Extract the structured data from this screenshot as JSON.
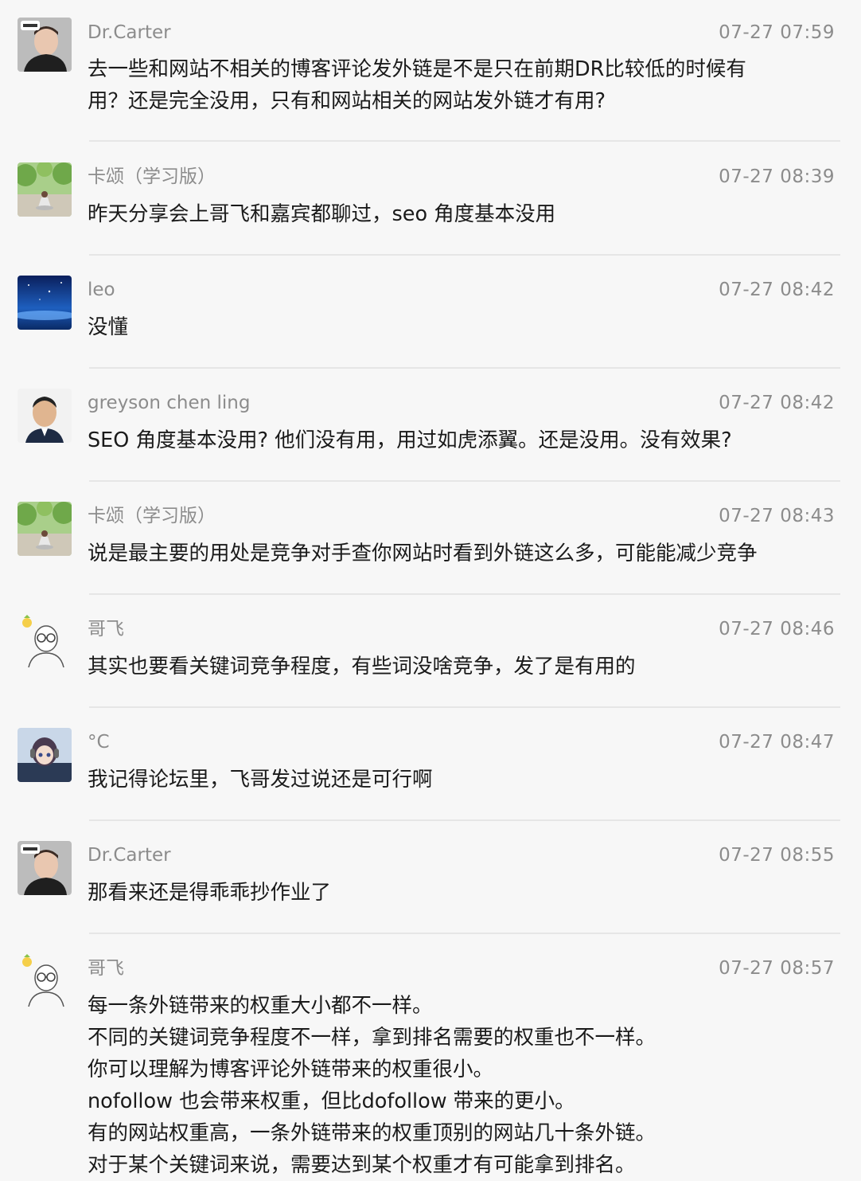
{
  "messages": [
    {
      "name": "Dr.Carter",
      "time": "07-27 07:59",
      "text": "去一些和网站不相关的博客评论发外链是不是只在前期DR比较低的时候有\n用？还是完全没用，只有和网站相关的网站发外链才有用?",
      "avatar": "person-photo-icon"
    },
    {
      "name": "卡颂（学习版）",
      "time": "07-27 08:39",
      "text": "昨天分享会上哥飞和嘉宾都聊过，seo 角度基本没用",
      "avatar": "meditation-park-icon"
    },
    {
      "name": "leo",
      "time": "07-27 08:42",
      "text": "没懂",
      "avatar": "starry-sky-icon"
    },
    {
      "name": "greyson chen ling",
      "time": "07-27 08:42",
      "text": "SEO 角度基本没用? 他们没有用，用过如虎添翼。还是没用。没有效果?",
      "avatar": "person-portrait-icon"
    },
    {
      "name": "卡颂（学习版）",
      "time": "07-27 08:43",
      "text": "说是最主要的用处是竞争对手查你网站时看到外链这么多，可能能减少竞争",
      "avatar": "meditation-park-icon"
    },
    {
      "name": "哥飞",
      "time": "07-27 08:46",
      "text": "其实也要看关键词竞争程度，有些词没啥竞争，发了是有用的",
      "avatar": "cartoon-glasses-man-icon"
    },
    {
      "name": "°C",
      "time": "07-27 08:47",
      "text": "我记得论坛里，飞哥发过说还是可行啊",
      "avatar": "anime-girl-icon"
    },
    {
      "name": "Dr.Carter",
      "time": "07-27 08:55",
      "text": "那看来还是得乖乖抄作业了",
      "avatar": "person-photo-icon"
    },
    {
      "name": "哥飞",
      "time": "07-27 08:57",
      "text": "每一条外链带来的权重大小都不一样。\n不同的关键词竞争程度不一样，拿到排名需要的权重也不一样。\n你可以理解为博客评论外链带来的权重很小。\nnofollow 也会带来权重，但比dofollow 带来的更小。\n有的网站权重高，一条外链带来的权重顶别的网站几十条外链。\n对于某个关键词来说，需要达到某个权重才有可能拿到排名。",
      "avatar": "cartoon-glasses-man-icon"
    }
  ]
}
